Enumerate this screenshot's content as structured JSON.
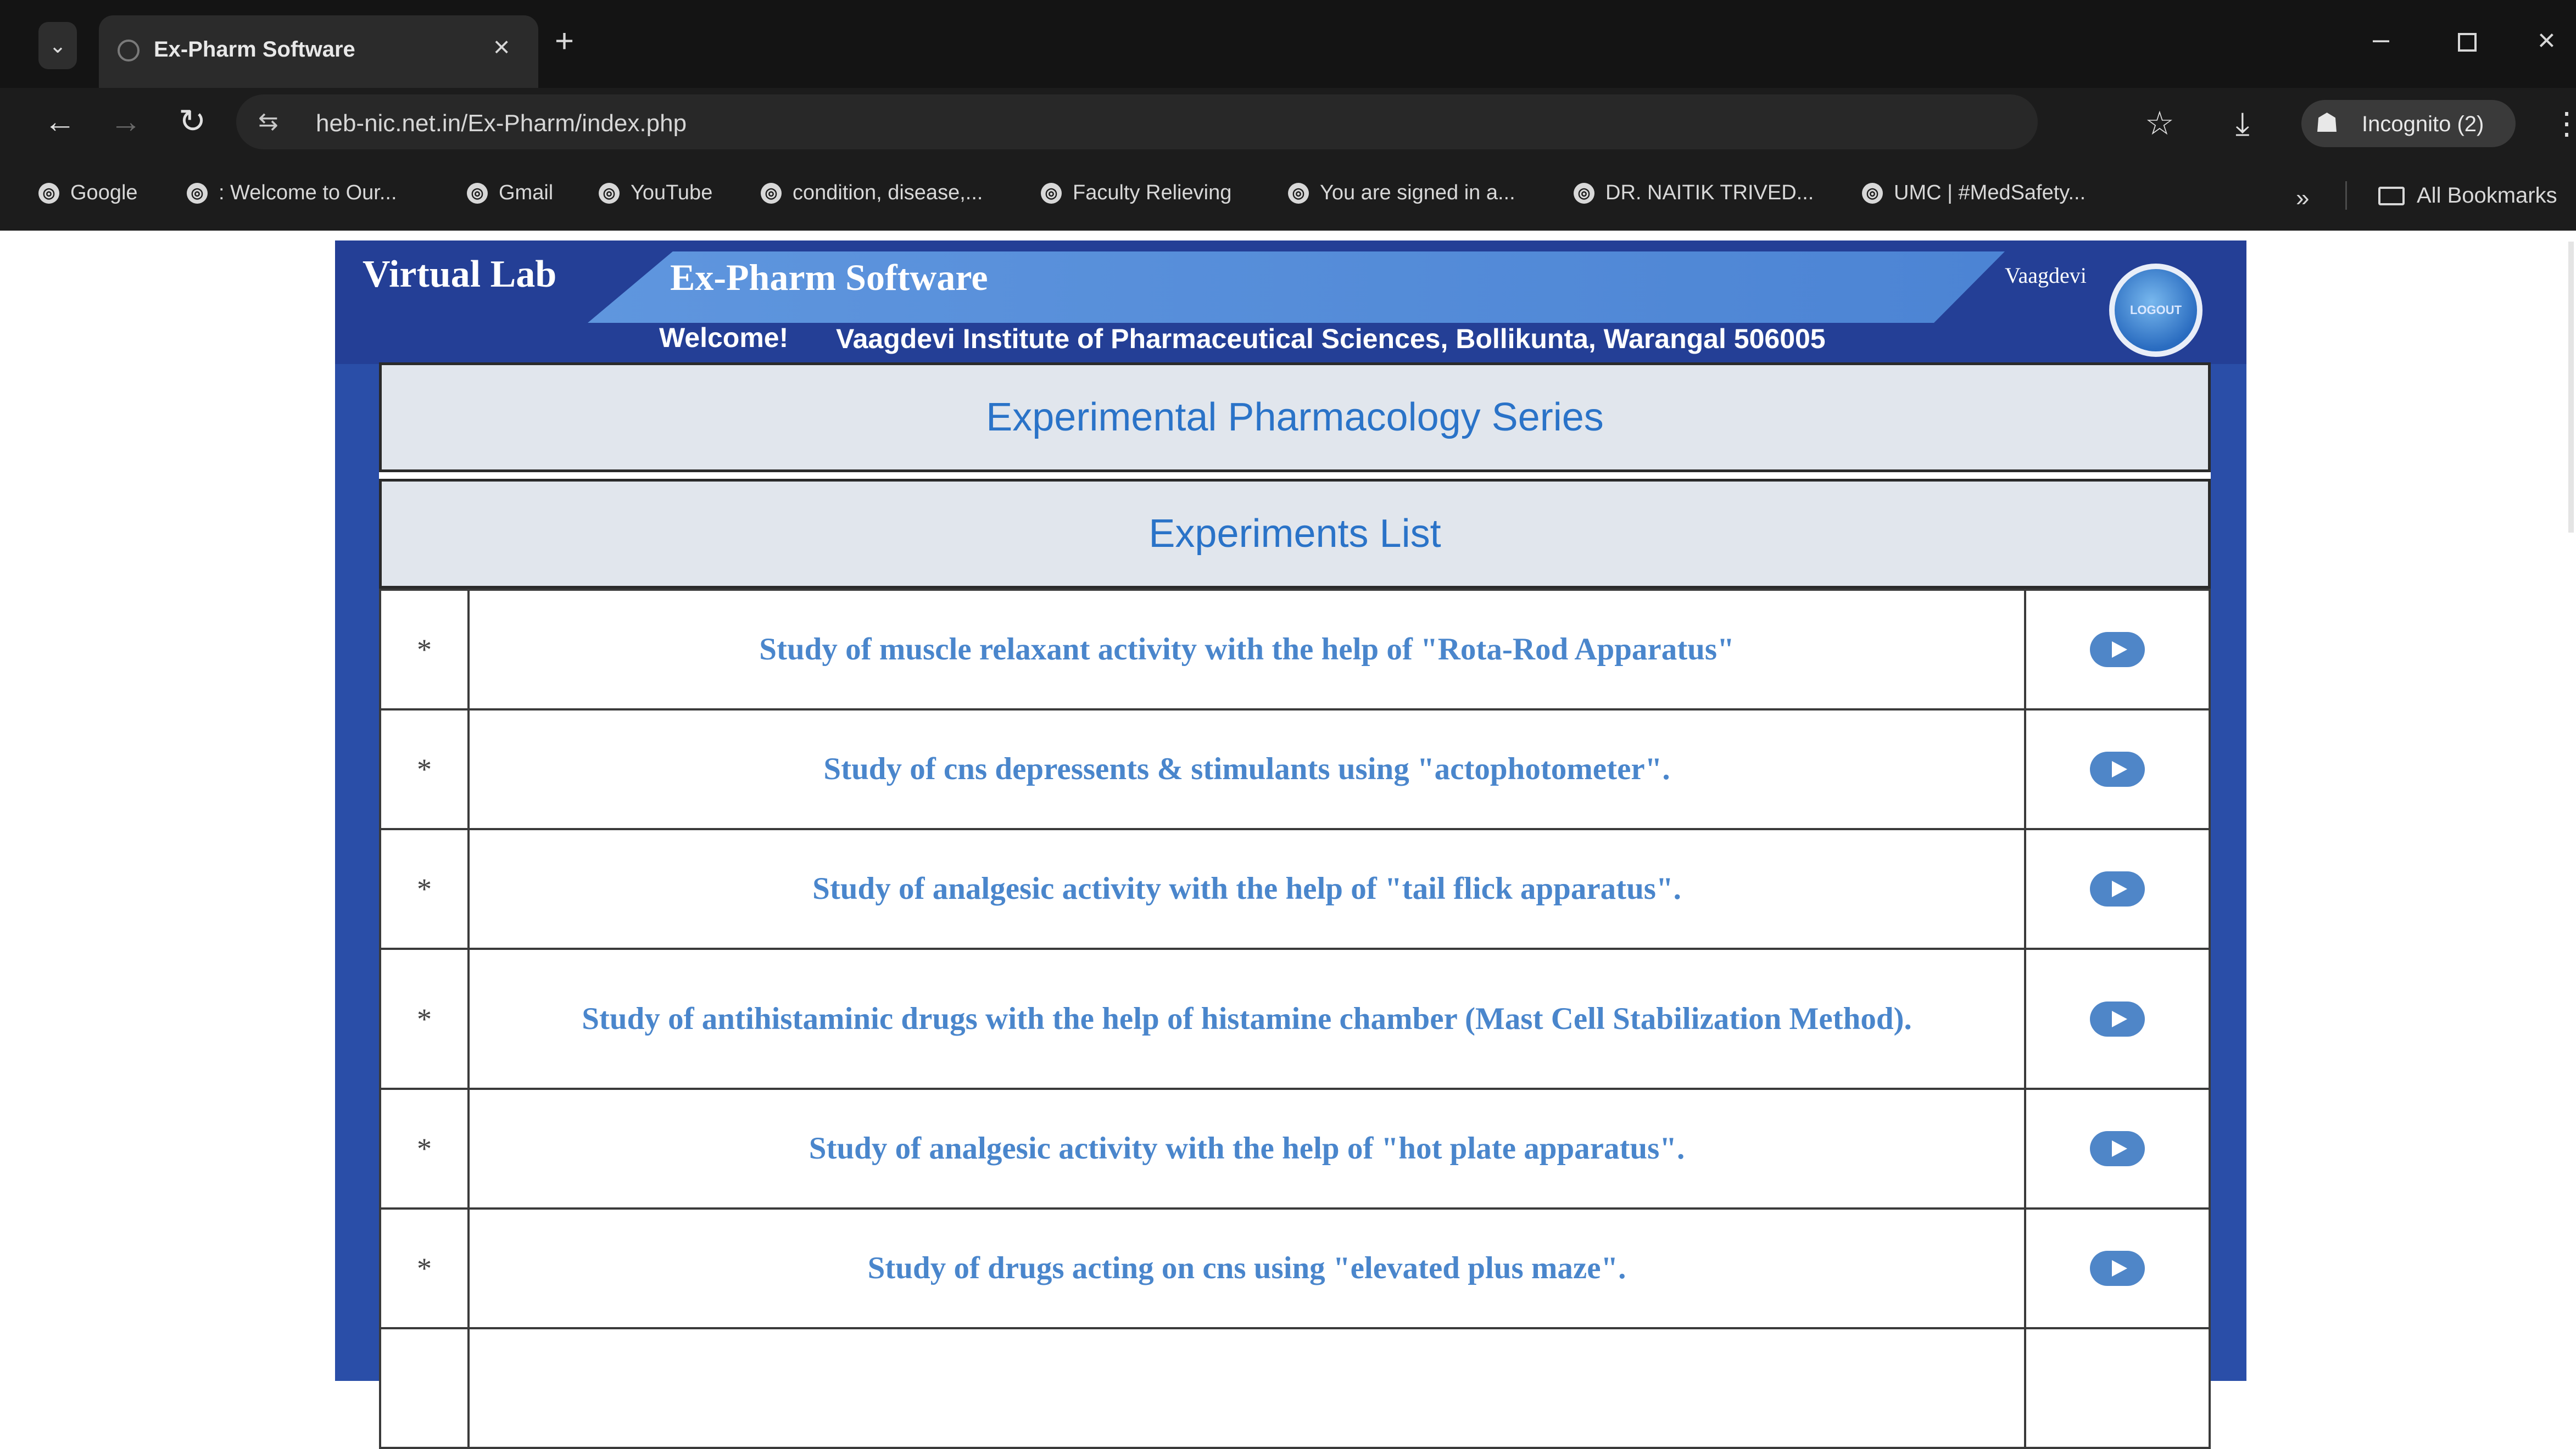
{
  "browser": {
    "tab_title": "Ex-Pharm Software",
    "tab_close": "×",
    "new_tab": "+",
    "url": "heb-nic.net.in/Ex-Pharm/index.php",
    "incognito_label": "Incognito (2)",
    "bookmarks": [
      "Google",
      ": Welcome to Our...",
      "Gmail",
      "YouTube",
      "condition, disease,...",
      "Faculty Relieving",
      "You are signed in a...",
      "DR. NAITIK TRIVED...",
      "UMC | #MedSafety..."
    ],
    "bookmarks_more": "»",
    "all_bookmarks": "All Bookmarks"
  },
  "site": {
    "lab_title": "Virtual Lab",
    "software_title": "Ex-Pharm Software",
    "user_name": "Vaagdevi",
    "logout_label": "LOGOUT",
    "welcome_label": "Welcome!",
    "institute": "Vaagdevi Institute of Pharmaceutical Sciences, Bollikunta, Warangal 506005",
    "series_title": "Experimental Pharmacology Series",
    "list_title": "Experiments List"
  },
  "experiments": [
    {
      "bullet": "*",
      "title": "Study of muscle relaxant activity with the help of \"Rota-Rod Apparatus\""
    },
    {
      "bullet": "*",
      "title": "Study of cns depressents & stimulants using \"actophotometer\"."
    },
    {
      "bullet": "*",
      "title": "Study of analgesic activity with the help of \"tail flick apparatus\"."
    },
    {
      "bullet": "*",
      "title": "Study of antihistaminic drugs with the help of histamine chamber (Mast Cell Stabilization Method)."
    },
    {
      "bullet": "*",
      "title": "Study of analgesic activity with the help of \"hot plate apparatus\"."
    },
    {
      "bullet": "*",
      "title": "Study of drugs acting on cns using \"elevated plus maze\"."
    }
  ]
}
